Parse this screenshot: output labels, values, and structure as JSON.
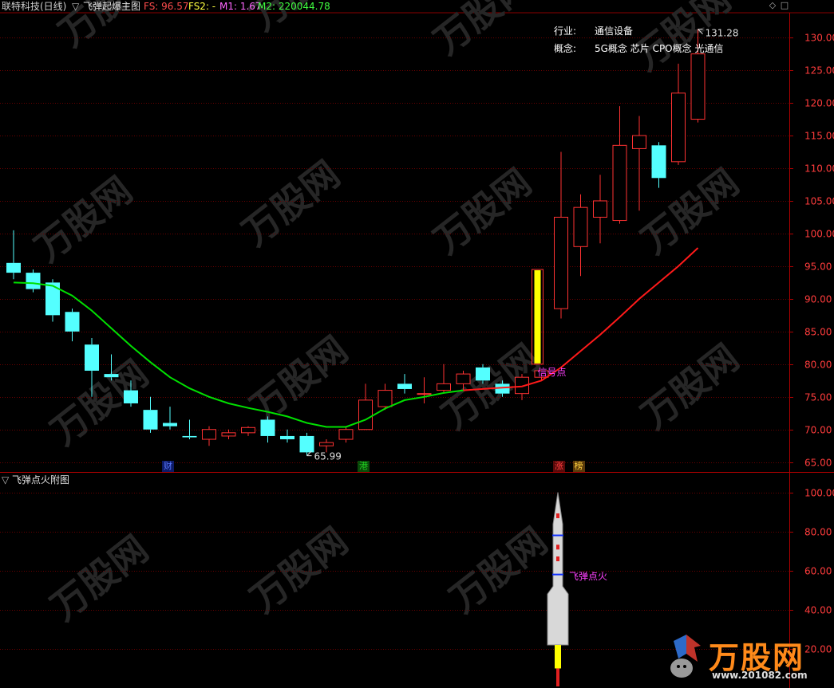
{
  "header": {
    "stock_name": "联特科技(日线)",
    "indicator_name": "飞弹起爆主图",
    "fs_label": "FS: 96.57",
    "fs2_label": "FS2: -",
    "m1_label": "M1: 1.67",
    "m2_label": "M2: 220044.78"
  },
  "sub_panel": {
    "title": "飞弹点火附图",
    "signal_label": "飞弹点火"
  },
  "info_box": {
    "industry_key": "行业:",
    "industry_value": "通信设备",
    "concept_key": "概念:",
    "concept_value": "5G概念 芯片 CPO概念 光通信"
  },
  "annotations": {
    "high_label": "131.28",
    "low_label": "65.99",
    "signal_point": "信号点"
  },
  "badges": [
    {
      "text": "财",
      "color": "#5a78ff",
      "bg": "#0d1a66"
    },
    {
      "text": "港",
      "color": "#20d020",
      "bg": "#0a4a0a"
    },
    {
      "text": "涨",
      "color": "#ff4040",
      "bg": "#5a0a0a"
    },
    {
      "text": "榜",
      "color": "#ffd040",
      "bg": "#5a3a0a"
    }
  ],
  "watermark_text": "万股网",
  "logo": {
    "name": "万股网",
    "url_text": "www.201082.com"
  },
  "colors": {
    "up": "#ff3232",
    "down": "#54ffff",
    "ma_green": "#00e000",
    "ma_red": "#ff1a1a",
    "grid": "#6a0000",
    "signal": "#ffff00",
    "magenta": "#ff40ff"
  },
  "chart_data": [
    {
      "type": "candlestick",
      "title": "飞弹起爆主图",
      "ylim": [
        63.5,
        133.8
      ],
      "ticks": [
        65,
        70,
        75,
        80,
        85,
        90,
        95,
        100,
        105,
        110,
        115,
        120,
        125,
        130
      ],
      "candles": [
        {
          "o": 95.5,
          "h": 100.5,
          "l": 93.0,
          "c": 94.0
        },
        {
          "o": 94.0,
          "h": 94.5,
          "l": 91.0,
          "c": 91.5
        },
        {
          "o": 92.5,
          "h": 93.0,
          "l": 86.5,
          "c": 87.5
        },
        {
          "o": 88.0,
          "h": 88.5,
          "l": 83.5,
          "c": 85.0
        },
        {
          "o": 83.0,
          "h": 84.0,
          "l": 75.0,
          "c": 79.0
        },
        {
          "o": 78.5,
          "h": 81.5,
          "l": 77.5,
          "c": 78.0
        },
        {
          "o": 76.0,
          "h": 77.5,
          "l": 73.5,
          "c": 74.0
        },
        {
          "o": 73.0,
          "h": 75.0,
          "l": 69.5,
          "c": 70.0
        },
        {
          "o": 71.0,
          "h": 73.5,
          "l": 70.0,
          "c": 70.5
        },
        {
          "o": 69.0,
          "h": 71.5,
          "l": 68.5,
          "c": 68.8
        },
        {
          "o": 68.5,
          "h": 70.5,
          "l": 67.5,
          "c": 70.0
        },
        {
          "o": 69.0,
          "h": 70.0,
          "l": 68.5,
          "c": 69.5
        },
        {
          "o": 69.5,
          "h": 70.5,
          "l": 69.0,
          "c": 70.3
        },
        {
          "o": 71.5,
          "h": 72.0,
          "l": 68.0,
          "c": 69.0
        },
        {
          "o": 69.0,
          "h": 70.0,
          "l": 68.0,
          "c": 68.5
        },
        {
          "o": 69.0,
          "h": 69.5,
          "l": 65.99,
          "c": 66.5
        },
        {
          "o": 67.5,
          "h": 68.5,
          "l": 66.5,
          "c": 68.0
        },
        {
          "o": 68.5,
          "h": 70.5,
          "l": 68.0,
          "c": 70.0
        },
        {
          "o": 70.0,
          "h": 77.0,
          "l": 70.0,
          "c": 74.5
        },
        {
          "o": 73.5,
          "h": 77.0,
          "l": 73.0,
          "c": 76.0
        },
        {
          "o": 77.0,
          "h": 78.5,
          "l": 75.5,
          "c": 76.2
        },
        {
          "o": 75.5,
          "h": 78.0,
          "l": 74.0,
          "c": 75.5
        },
        {
          "o": 76.0,
          "h": 80.0,
          "l": 75.5,
          "c": 77.0
        },
        {
          "o": 77.0,
          "h": 79.0,
          "l": 76.0,
          "c": 78.5
        },
        {
          "o": 79.5,
          "h": 80.0,
          "l": 77.0,
          "c": 77.5
        },
        {
          "o": 77.0,
          "h": 77.5,
          "l": 75.0,
          "c": 75.5
        },
        {
          "o": 75.5,
          "h": 78.5,
          "l": 74.5,
          "c": 78.0
        },
        {
          "o": 78.0,
          "h": 79.0,
          "l": 77.5,
          "c": 79.0
        },
        {
          "o": 88.5,
          "h": 112.5,
          "l": 87.0,
          "c": 102.5
        },
        {
          "o": 98.0,
          "h": 106.0,
          "l": 93.5,
          "c": 104.0
        },
        {
          "o": 102.5,
          "h": 109.0,
          "l": 98.5,
          "c": 105.0
        },
        {
          "o": 102.0,
          "h": 119.5,
          "l": 101.5,
          "c": 113.5
        },
        {
          "o": 113.0,
          "h": 118.0,
          "l": 103.5,
          "c": 115.0
        },
        {
          "o": 113.5,
          "h": 114.0,
          "l": 107.0,
          "c": 108.5
        },
        {
          "o": 111.0,
          "h": 126.0,
          "l": 110.5,
          "c": 121.5
        },
        {
          "o": 117.5,
          "h": 131.28,
          "l": 117.0,
          "c": 127.5
        }
      ],
      "ma_line": [
        92.5,
        92.4,
        92.0,
        90.5,
        88.2,
        85.5,
        82.8,
        80.3,
        78.0,
        76.3,
        75.0,
        74.0,
        73.3,
        72.7,
        72.0,
        71.0,
        70.4,
        70.4,
        71.5,
        73.2,
        74.5,
        75.0,
        75.6,
        76.0,
        76.2,
        76.4,
        76.6,
        77.5,
        79.5,
        82.0,
        84.5,
        87.2,
        90.0,
        92.5,
        95.0,
        97.8
      ],
      "ma_color_switch_index": 23,
      "signal_bar": {
        "index": 27,
        "from": 80.0,
        "to": 94.5
      },
      "badges_at_index": [
        8,
        18,
        28,
        29
      ]
    },
    {
      "type": "bar",
      "title": "飞弹点火附图",
      "ylim": [
        0,
        110
      ],
      "ticks": [
        20.0,
        40.0,
        60.0,
        80.0,
        100.0
      ],
      "signal_index": 28,
      "signal_value": 100
    }
  ]
}
